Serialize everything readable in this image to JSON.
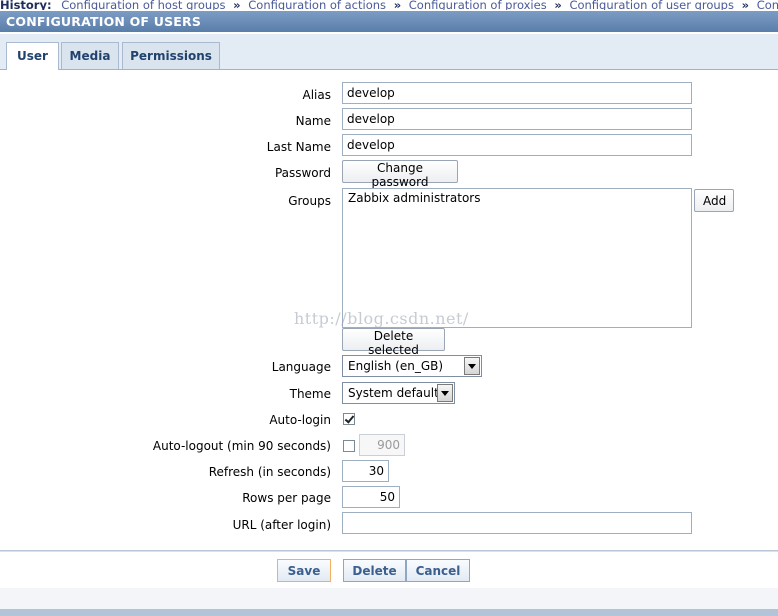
{
  "history": {
    "label": "History:",
    "items": [
      "Configuration of host groups",
      "Configuration of actions",
      "Configuration of proxies",
      "Configuration of user groups",
      "Configuration of"
    ],
    "separator": "»"
  },
  "page_title": "CONFIGURATION OF USERS",
  "tabs": [
    {
      "label": "User",
      "active": true
    },
    {
      "label": "Media",
      "active": false
    },
    {
      "label": "Permissions",
      "active": false
    }
  ],
  "form": {
    "alias": {
      "label": "Alias",
      "value": "develop"
    },
    "name": {
      "label": "Name",
      "value": "develop"
    },
    "last_name": {
      "label": "Last Name",
      "value": "develop"
    },
    "password": {
      "label": "Password",
      "button": "Change password"
    },
    "groups": {
      "label": "Groups",
      "items": [
        "Zabbix administrators"
      ],
      "add_button": "Add",
      "delete_button": "Delete selected"
    },
    "language": {
      "label": "Language",
      "value": "English (en_GB)"
    },
    "theme": {
      "label": "Theme",
      "value": "System default"
    },
    "auto_login": {
      "label": "Auto-login",
      "checked": true
    },
    "auto_logout": {
      "label": "Auto-logout (min 90 seconds)",
      "checked": false,
      "value": "900"
    },
    "refresh": {
      "label": "Refresh (in seconds)",
      "value": "30"
    },
    "rows_per_page": {
      "label": "Rows per page",
      "value": "50"
    },
    "url": {
      "label": "URL (after login)",
      "value": ""
    }
  },
  "watermark": "http://blog.csdn.net/",
  "footer": {
    "save": "Save",
    "delete": "Delete",
    "cancel": "Cancel"
  },
  "colors": {
    "titlebar": "#6a8db8",
    "tab_text": "#22426e",
    "footer_text": "#3b5f8e",
    "save_border": "#f0b060"
  }
}
